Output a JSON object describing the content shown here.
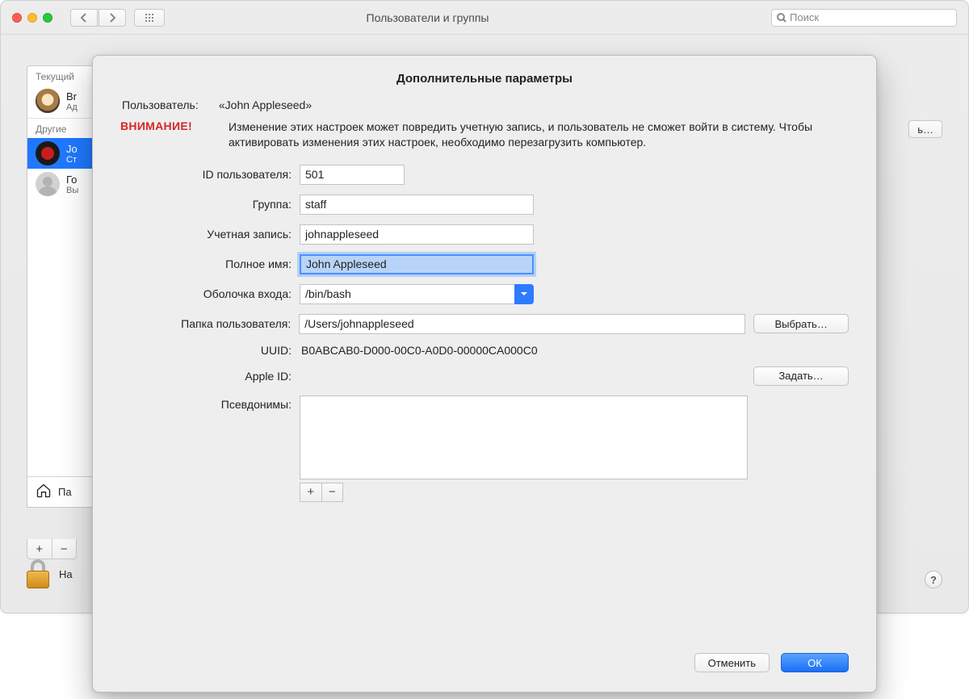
{
  "window": {
    "title": "Пользователи и группы",
    "search_placeholder": "Поиск",
    "bg_change_button": "ь…"
  },
  "sidebar": {
    "section_current": "Текущий",
    "section_other": "Другие",
    "current_user": {
      "name_trunc": "Br",
      "role_trunc": "Ад"
    },
    "other_users": [
      {
        "name_trunc": "Jo",
        "role_trunc": "Ст",
        "selected": true,
        "avatar": "red"
      },
      {
        "name_trunc": "Го",
        "role_trunc": "Вы",
        "selected": false,
        "avatar": "blank"
      }
    ],
    "login_options_trunc": "Па",
    "lock_text_trunc": "На"
  },
  "sheet": {
    "title": "Дополнительные параметры",
    "user_label": "Пользователь:",
    "user_value": "«John Appleseed»",
    "warning_badge": "ВНИМАНИЕ!",
    "warning_text": "Изменение этих настроек может повредить учетную запись, и пользователь не сможет войти в систему. Чтобы активировать изменения этих настроек, необходимо перезагрузить компьютер.",
    "labels": {
      "user_id": "ID пользователя:",
      "group": "Группа:",
      "account": "Учетная запись:",
      "full_name": "Полное имя:",
      "login_shell": "Оболочка входа:",
      "home_dir": "Папка пользователя:",
      "uuid": "UUID:",
      "apple_id": "Apple ID:",
      "aliases": "Псевдонимы:"
    },
    "values": {
      "user_id": "501",
      "group": "staff",
      "account": "johnappleseed",
      "full_name": "John Appleseed",
      "login_shell": "/bin/bash",
      "home_dir": "/Users/johnappleseed",
      "uuid": "B0ABCAB0-D000-00C0-A0D0-00000CA000C0",
      "apple_id": ""
    },
    "buttons": {
      "choose": "Выбрать…",
      "set": "Задать…",
      "cancel": "Отменить",
      "ok": "ОК"
    }
  }
}
